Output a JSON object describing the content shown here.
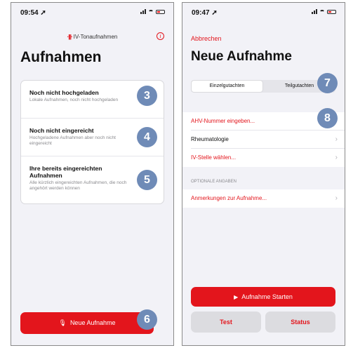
{
  "left_screen": {
    "status_time": "09:54",
    "brand_name": "IV-Tonaufnahmen",
    "title": "Aufnahmen",
    "items": [
      {
        "title": "Noch nicht hochgeladen",
        "subtitle": "Lokale Aufnahmen, noch nicht hochgeladen",
        "badge": "3"
      },
      {
        "title": "Noch nicht eingereicht",
        "subtitle": "Hochgeladene Aufnahmen aber noch nicht eingereicht",
        "badge": "4"
      },
      {
        "title": "Ihre bereits eingereichten Aufnahmen",
        "subtitle": "Alle kürzlich eingereichten Aufnahmen, die noch angehört werden können",
        "badge": "5"
      }
    ],
    "new_recording_label": "Neue Aufnahme",
    "new_recording_badge": "6"
  },
  "right_screen": {
    "status_time": "09:47",
    "cancel_label": "Abbrechen",
    "title": "Neue Aufnahme",
    "tabs": [
      "Einzelgutachten",
      "Teilgutachten"
    ],
    "tabs_badge": "7",
    "rows": [
      {
        "label": "AHV-Nummer eingeben...",
        "color": "red",
        "badge": "8"
      },
      {
        "label": "Rheumatologie",
        "color": "default"
      },
      {
        "label": "IV-Stelle wählen...",
        "color": "red"
      }
    ],
    "optional_header": "OPTIONALE ANGABEN",
    "optional_rows": [
      {
        "label": "Anmerkungen zur Aufnahme...",
        "color": "red"
      }
    ],
    "start_label": "Aufnahme Starten",
    "test_label": "Test",
    "status_label": "Status"
  },
  "colors": {
    "accent": "#e3151c",
    "badge": "#6f8bb7",
    "background": "#f2f2f7"
  },
  "icons": {
    "location_arrow": "location-arrow-icon",
    "info": "info-icon",
    "mic": "microphone-icon",
    "play": "play-icon",
    "chevron": "chevron-right-icon"
  }
}
